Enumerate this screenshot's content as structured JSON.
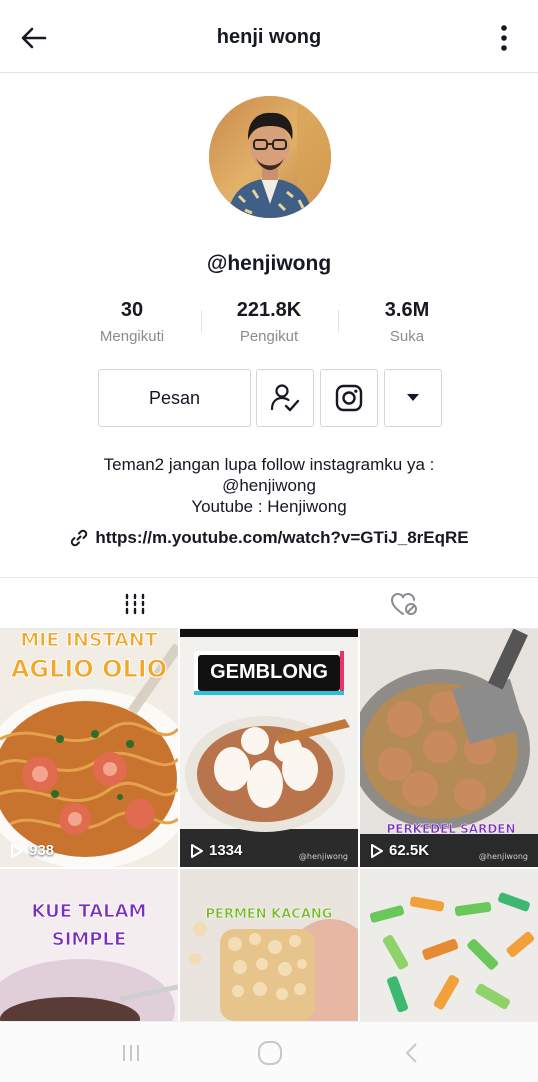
{
  "header": {
    "title": "henji wong"
  },
  "profile": {
    "username": "@henjiwong",
    "stats": [
      {
        "value": "30",
        "label": "Mengikuti"
      },
      {
        "value": "221.8K",
        "label": "Pengikut"
      },
      {
        "value": "3.6M",
        "label": "Suka"
      }
    ]
  },
  "actions": {
    "message_label": "Pesan"
  },
  "bio": {
    "line1": "Teman2 jangan lupa follow instagramku ya :",
    "line2": "@henjiwong",
    "line3": "Youtube : Henjiwong",
    "link": "https://m.youtube.com/watch?v=GTiJ_8rEqRE"
  },
  "videos": [
    {
      "title": "MIE INSTANT AGLIO OLIO",
      "title_line1": "MIE INSTANT",
      "title_line2": "AGLIO OLIO",
      "views": "938"
    },
    {
      "title": "GEMBLONG",
      "views": "1334",
      "watermark": "@henjiwong"
    },
    {
      "title": "PERKEDEL SARDEN",
      "views": "62.5K",
      "watermark": "@henjiwong"
    },
    {
      "title": "KUE TALAM SIMPLE",
      "title_line1": "KUE TALAM",
      "title_line2": "SIMPLE"
    },
    {
      "title": "PERMEN KACANG"
    },
    {
      "title": ""
    }
  ],
  "colors": {
    "text_primary": "#161823",
    "text_secondary": "#8a8b91",
    "border": "#d5d5d8",
    "overlay_orange": "#f5a623",
    "overlay_purple": "#7b2fbe",
    "overlay_yellow": "#f2e600"
  },
  "icons": {
    "back": "arrow-left-icon",
    "more": "vertical-dots-icon",
    "follow_status": "user-check-icon",
    "instagram": "instagram-icon",
    "dropdown": "triangle-down-icon",
    "link": "link-icon",
    "grid_tab": "grid-bars-icon",
    "liked_tab": "hidden-heart-icon",
    "play": "play-outline-icon"
  }
}
